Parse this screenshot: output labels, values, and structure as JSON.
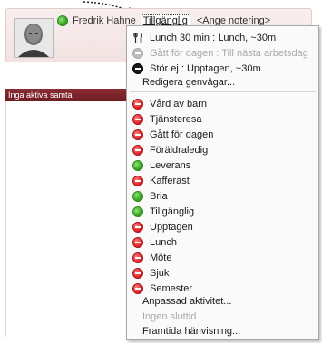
{
  "header": {
    "user_name": "Fredrik Hahne",
    "status_label": "Tillgänglig",
    "note_placeholder": "<Ange notering>",
    "status_color": "#35a521"
  },
  "banner": {
    "text": "Inga aktiva samtal"
  },
  "menu": {
    "recent": [
      {
        "label": "Lunch 30 min : Lunch, ~30m",
        "icon": "fork-knife-icon",
        "disabled": false
      },
      {
        "label": "Gått för dagen : Till nästa arbetsdag",
        "icon": "gray-minus-icon",
        "disabled": true
      },
      {
        "label": "Stör ej : Upptagen, ~30m",
        "icon": "black-minus-icon",
        "disabled": false
      }
    ],
    "edit_shortcuts": "Redigera genvägar...",
    "statuses": [
      {
        "label": "Vård av barn",
        "icon": "red-minus-icon"
      },
      {
        "label": "Tjänsteresa",
        "icon": "red-minus-icon"
      },
      {
        "label": "Gått för dagen",
        "icon": "red-minus-icon"
      },
      {
        "label": "Föräldraledig",
        "icon": "red-minus-icon"
      },
      {
        "label": "Leverans",
        "icon": "green-dot-icon"
      },
      {
        "label": "Kafferast",
        "icon": "red-minus-icon"
      },
      {
        "label": "Bria",
        "icon": "green-dot-icon"
      },
      {
        "label": "Tillgänglig",
        "icon": "green-dot-icon"
      },
      {
        "label": "Upptagen",
        "icon": "red-minus-icon"
      },
      {
        "label": "Lunch",
        "icon": "red-minus-icon"
      },
      {
        "label": "Möte",
        "icon": "red-minus-icon"
      },
      {
        "label": "Sjuk",
        "icon": "red-minus-icon"
      },
      {
        "label": "Semester",
        "icon": "red-minus-icon"
      }
    ],
    "custom_activity": "Anpassad aktivitet...",
    "no_end_time": "Ingen sluttid",
    "forwarding": "Framtida hänvisning..."
  },
  "colors": {
    "green": "#35a521",
    "red": "#e0262a",
    "banner": "#7a2229",
    "header_bg": "#f5e6e6"
  }
}
